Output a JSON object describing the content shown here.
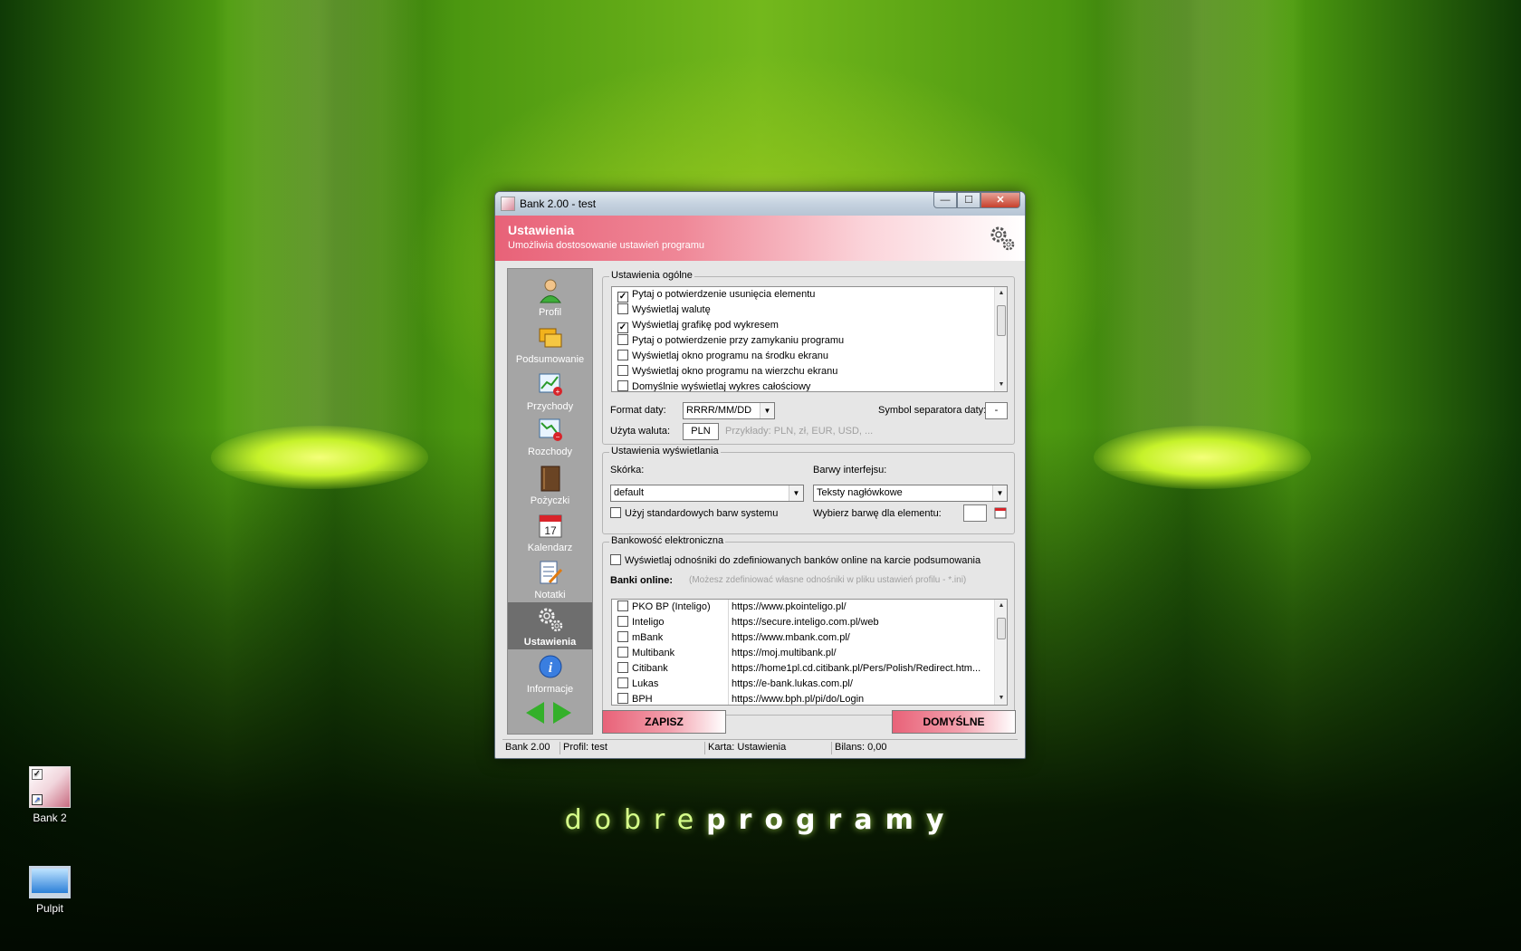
{
  "desktop": {
    "brand_light": "dobre",
    "brand_bold": "programy",
    "icons": [
      {
        "label": "Bank 2"
      },
      {
        "label": "Pulpit"
      }
    ]
  },
  "window": {
    "title": "Bank 2.00 - test",
    "controls": {
      "minimize": "—",
      "maximize": "☐",
      "close": "✕"
    }
  },
  "header": {
    "title": "Ustawienia",
    "subtitle": "Umożliwia dostosowanie ustawień programu",
    "icon": "gears-icon"
  },
  "sidebar": {
    "items": [
      {
        "label": "Profil",
        "icon": "user-icon"
      },
      {
        "label": "Podsumowanie",
        "icon": "folders-icon"
      },
      {
        "label": "Przychody",
        "icon": "chart-income-icon"
      },
      {
        "label": "Rozchody",
        "icon": "chart-expense-icon"
      },
      {
        "label": "Pożyczki",
        "icon": "book-icon"
      },
      {
        "label": "Kalendarz",
        "icon": "calendar-icon",
        "day": "17"
      },
      {
        "label": "Notatki",
        "icon": "notes-icon"
      },
      {
        "label": "Ustawienia",
        "icon": "gears-icon"
      },
      {
        "label": "Informacje",
        "icon": "info-icon"
      }
    ],
    "active": "Ustawienia"
  },
  "general": {
    "title": "Ustawienia ogólne",
    "options": [
      {
        "label": "Pytaj o potwierdzenie usunięcia elementu",
        "checked": true
      },
      {
        "label": "Wyświetlaj walutę",
        "checked": false
      },
      {
        "label": "Wyświetlaj grafikę pod wykresem",
        "checked": true
      },
      {
        "label": "Pytaj o potwierdzenie przy zamykaniu programu",
        "checked": false
      },
      {
        "label": "Wyświetlaj okno programu na środku ekranu",
        "checked": false
      },
      {
        "label": "Wyświetlaj okno programu na wierzchu ekranu",
        "checked": false
      },
      {
        "label": "Domyślnie wyświetlaj wykres całościowy",
        "checked": false
      }
    ],
    "date_format_label": "Format daty:",
    "date_format_value": "RRRR/MM/DD",
    "date_sep_label": "Symbol separatora daty:",
    "date_sep_value": "-",
    "currency_label": "Użyta waluta:",
    "currency_value": "PLN",
    "currency_hint": "Przykłady: PLN, zł, EUR, USD, ..."
  },
  "display": {
    "title": "Ustawienia wyświetlania",
    "skin_label": "Skórka:",
    "skin_value": "default",
    "colors_label": "Barwy interfejsu:",
    "colors_value": "Teksty nagłówkowe",
    "system_colors_label": "Użyj standardowych barw systemu",
    "pick_color_label": "Wybierz barwę dla elementu:"
  },
  "ebanking": {
    "title": "Bankowość elektroniczna",
    "show_links_label": "Wyświetlaj odnośniki do zdefiniowanych banków online na karcie podsumowania",
    "banks_label": "Banki online:",
    "banks_hint": "(Możesz zdefiniować własne odnośniki w pliku ustawień profilu - *.ini)",
    "banks": [
      {
        "name": "PKO BP (Inteligo)",
        "url": "https://www.pkointeligo.pl/"
      },
      {
        "name": "Inteligo",
        "url": "https://secure.inteligo.com.pl/web"
      },
      {
        "name": "mBank",
        "url": "https://www.mbank.com.pl/"
      },
      {
        "name": "Multibank",
        "url": "https://moj.multibank.pl/"
      },
      {
        "name": "Citibank",
        "url": "https://home1pl.cd.citibank.pl/Pers/Polish/Redirect.htm..."
      },
      {
        "name": "Lukas",
        "url": "https://e-bank.lukas.com.pl/"
      },
      {
        "name": "BPH",
        "url": "https://www.bph.pl/pi/do/Login"
      }
    ]
  },
  "buttons": {
    "save": "ZAPISZ",
    "defaults": "DOMYŚLNE"
  },
  "status": {
    "app": "Bank 2.00",
    "profile": "Profil: test",
    "card": "Karta: Ustawienia",
    "balance": "Bilans: 0,00"
  },
  "colors": {
    "accent_pink": "#e86278",
    "nav_bg": "#a5a5a5",
    "nav_active": "#6e6e6e",
    "arrow_green": "#34b02a"
  }
}
